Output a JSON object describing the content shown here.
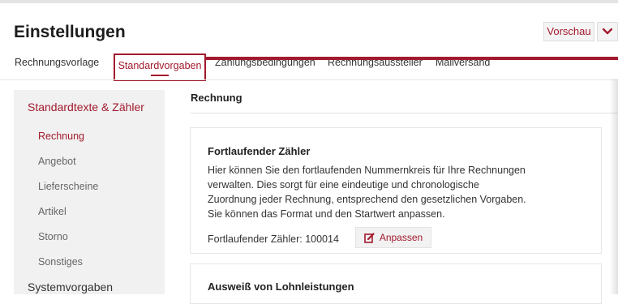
{
  "header": {
    "title": "Einstellungen",
    "preview_label": "Vorschau"
  },
  "tabs": [
    {
      "label": "Rechnungsvorlage",
      "active": false
    },
    {
      "label": "Standardvorgaben",
      "active": true
    },
    {
      "label": "Zahlungsbedingungen",
      "active": false
    },
    {
      "label": "Rechnungsaussteller",
      "active": false
    },
    {
      "label": "Mailversand",
      "active": false
    }
  ],
  "sidebar": {
    "header": "Standardtexte & Zähler",
    "items": [
      {
        "label": "Rechnung",
        "active": true
      },
      {
        "label": "Angebot",
        "active": false
      },
      {
        "label": "Lieferscheine",
        "active": false
      },
      {
        "label": "Artikel",
        "active": false
      },
      {
        "label": "Storno",
        "active": false
      },
      {
        "label": "Sonstiges",
        "active": false
      }
    ],
    "header2": "Systemvorgaben"
  },
  "main": {
    "section_title": "Rechnung",
    "card": {
      "title": "Fortlaufender Zähler",
      "description_lines": [
        "Hier können Sie den fortlaufenden Nummernkreis für Ihre Rechnungen",
        "verwalten. Dies sorgt für eine eindeutige und chronologische",
        "Zuordnung jeder Rechnung, entsprechend den gesetzlichen Vorgaben.",
        "Sie können das Format und den Startwert anpassen."
      ],
      "counter_label": "Fortlaufender Zähler: 100014",
      "adjust_label": "Anpassen"
    },
    "card2": {
      "title": "Ausweiß von Lohnleistungen"
    }
  },
  "colors": {
    "accent": "#a31a2e",
    "sidebar_bg": "#f1f1f1"
  }
}
